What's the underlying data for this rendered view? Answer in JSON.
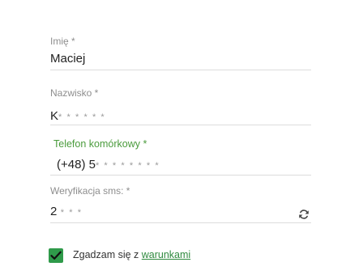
{
  "form": {
    "imie": {
      "label": "Imię *",
      "value": "Maciej"
    },
    "nazwisko": {
      "label": "Nazwisko *",
      "value": "K",
      "mask": "******"
    },
    "telefon": {
      "label": "Telefon komórkowy *",
      "value": "(+48) 5",
      "mask": "********"
    },
    "sms": {
      "label": "Weryfikacja sms: *",
      "value": "2",
      "mask": "***",
      "refresh_icon": "refresh-icon"
    },
    "consent": {
      "checked": true,
      "text": "Zgadzam się z",
      "link": "warunkami",
      "check_icon": "checkmark-icon"
    }
  },
  "colors": {
    "active_label": "#4a9b3c",
    "checkbox": "#2f9a4a",
    "link": "#2f8a3f",
    "label": "#8e8e8e",
    "underline": "#dcdcdc"
  }
}
